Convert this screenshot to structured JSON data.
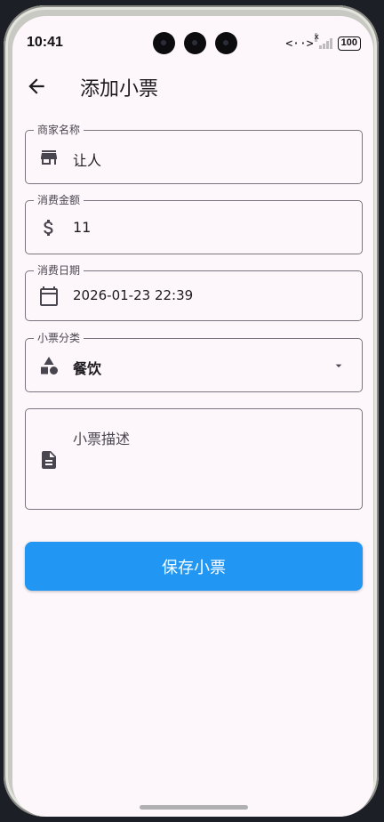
{
  "status_bar": {
    "time": "10:41",
    "network_arrows": "<··>",
    "signal_mark": "x",
    "battery": "100"
  },
  "app_bar": {
    "title": "添加小票",
    "back_icon": "arrow-left-icon"
  },
  "form": {
    "merchant": {
      "label": "商家名称",
      "value": "让人",
      "icon": "store-icon"
    },
    "amount": {
      "label": "消费金额",
      "value": "11",
      "icon": "dollar-icon"
    },
    "date": {
      "label": "消费日期",
      "value": "2026-01-23 22:39",
      "icon": "calendar-icon"
    },
    "category": {
      "label": "小票分类",
      "value": "餐饮",
      "icon": "category-shapes-icon"
    },
    "description": {
      "placeholder": "小票描述",
      "icon": "document-icon"
    }
  },
  "save_button": {
    "label": "保存小票"
  },
  "colors": {
    "accent": "#2196f3",
    "background": "#fdf7fb",
    "outline": "#79747e",
    "icon": "#49454f"
  }
}
